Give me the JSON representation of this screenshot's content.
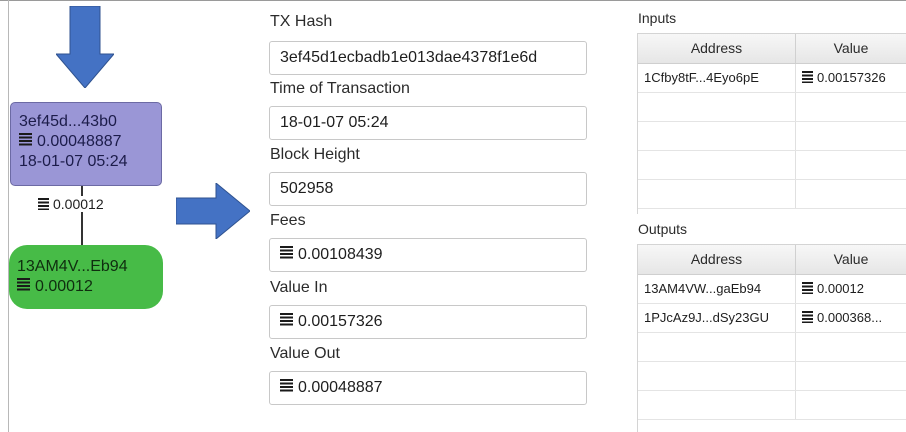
{
  "graph": {
    "tx_node": {
      "hash": "3ef45d...43b0",
      "value": "0.00048887",
      "time": "18-01-07 05:24"
    },
    "edge_value": "0.00012",
    "out_node": {
      "address": "13AM4V...Eb94",
      "value": "0.00012"
    }
  },
  "details": {
    "tx_hash_label": "TX Hash",
    "tx_hash_value": "3ef45d1ecbadb1e013dae4378f1e6d",
    "time_label": "Time of Transaction",
    "time_value": "18-01-07 05:24",
    "block_height_label": "Block Height",
    "block_height_value": "502958",
    "fees_label": "Fees",
    "fees_value": "0.00108439",
    "value_in_label": "Value In",
    "value_in_value": "0.00157326",
    "value_out_label": "Value Out",
    "value_out_value": "0.00048887"
  },
  "inputs": {
    "title": "Inputs",
    "columns": [
      "Address",
      "Value"
    ],
    "rows": [
      {
        "address": "1Cfby8tF...4Eyo6pE",
        "value": "0.00157326"
      }
    ]
  },
  "outputs": {
    "title": "Outputs",
    "columns": [
      "Address",
      "Value"
    ],
    "rows": [
      {
        "address": "13AM4VW...gaEb94",
        "value": "0.00012"
      },
      {
        "address": "1PJcAz9J...dSy23GU",
        "value": "0.000368..."
      }
    ]
  },
  "colors": {
    "tx_node": "#9a96d6",
    "out_node": "#47bb47",
    "arrow": "#4472c4"
  },
  "icons": [
    "ledger-icon",
    "down-arrow-icon",
    "right-arrow-icon"
  ]
}
